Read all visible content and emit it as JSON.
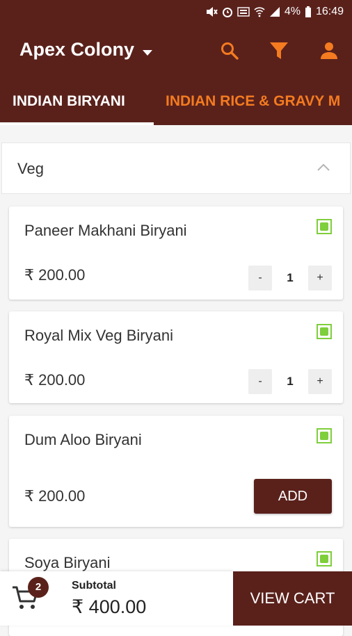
{
  "status_bar": {
    "battery_pct": "4%",
    "time": "16:49"
  },
  "app_bar": {
    "location": "Apex Colony"
  },
  "tabs": [
    {
      "label": "INDIAN BIRYANI",
      "active": true
    },
    {
      "label": "INDIAN RICE & GRAVY M",
      "active": false
    }
  ],
  "section": {
    "title": "Veg",
    "expanded": true
  },
  "items": [
    {
      "name": "Paneer Makhani Biryani",
      "price": "₹ 200.00",
      "qty": "1",
      "minus": "-",
      "plus": "+"
    },
    {
      "name": "Royal Mix Veg Biryani",
      "price": "₹ 200.00",
      "qty": "1",
      "minus": "-",
      "plus": "+"
    },
    {
      "name": "Dum Aloo Biryani",
      "price": "₹ 200.00",
      "add_label": "ADD"
    },
    {
      "name": "Soya Biryani"
    }
  ],
  "cart": {
    "count": "2",
    "subtotal_label": "Subtotal",
    "subtotal_value": "₹ 400.00",
    "view_cart_label": "VIEW CART"
  },
  "colors": {
    "primary": "#5a211b",
    "accent": "#f47b20",
    "veg_green": "#7fce3b"
  },
  "icons": [
    "mute-icon",
    "alarm-icon",
    "volte-icon",
    "wifi-icon",
    "signal-icon",
    "battery-icon",
    "dropdown-caret-icon",
    "search-icon",
    "filter-icon",
    "user-icon",
    "chevron-up-icon",
    "veg-mark-icon",
    "cart-icon"
  ]
}
